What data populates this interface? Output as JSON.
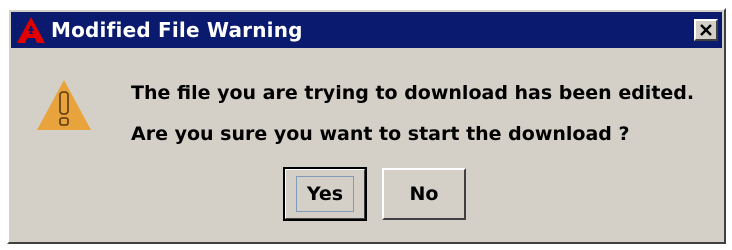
{
  "window": {
    "title": "Modified File Warning",
    "app_icon": "red-a-logo-icon",
    "close_icon": "close-icon"
  },
  "message": {
    "icon": "warning-icon",
    "line1": "The file you are trying to download has been edited.",
    "line2": "Are you sure you want to start the download ?"
  },
  "buttons": {
    "yes_label": "Yes",
    "no_label": "No"
  },
  "colors": {
    "titlebar": "#0a1a6e",
    "dialog_bg": "#d4d0c8",
    "logo_red": "#e00000",
    "warning_fill": "#e8a33c"
  }
}
